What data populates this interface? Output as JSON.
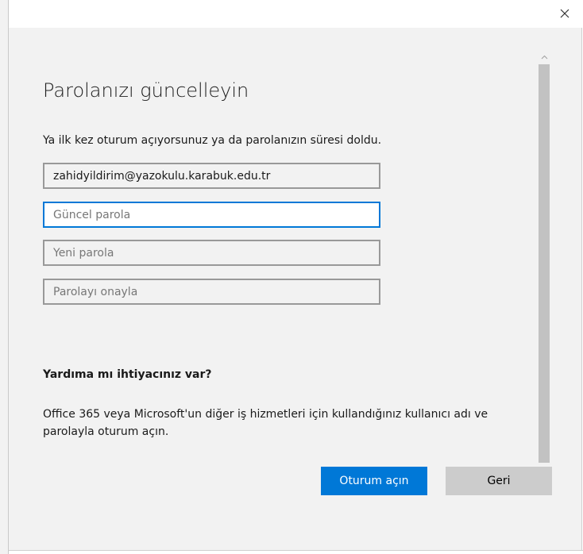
{
  "window": {
    "close_icon": "close-icon"
  },
  "form": {
    "title": "Parolanızı güncelleyin",
    "subtitle": "Ya ilk kez oturum açıyorsunuz ya da parolanızın süresi doldu.",
    "username_value": "zahidyildirim@yazokulu.karabuk.edu.tr",
    "current_password_placeholder": "Güncel parola",
    "new_password_placeholder": "Yeni parola",
    "confirm_password_placeholder": "Parolayı onayla"
  },
  "help": {
    "heading": "Yardıma mı ihtiyacınız var?",
    "text": "Office 365 veya Microsoft'un diğer iş hizmetleri için kullandığınız kullanıcı adı ve parolayla oturum açın."
  },
  "buttons": {
    "sign_in_label": "Oturum açın",
    "back_label": "Geri"
  },
  "colors": {
    "accent": "#0078d7",
    "background": "#f2f2f2",
    "secondary_button": "#cccccc"
  }
}
